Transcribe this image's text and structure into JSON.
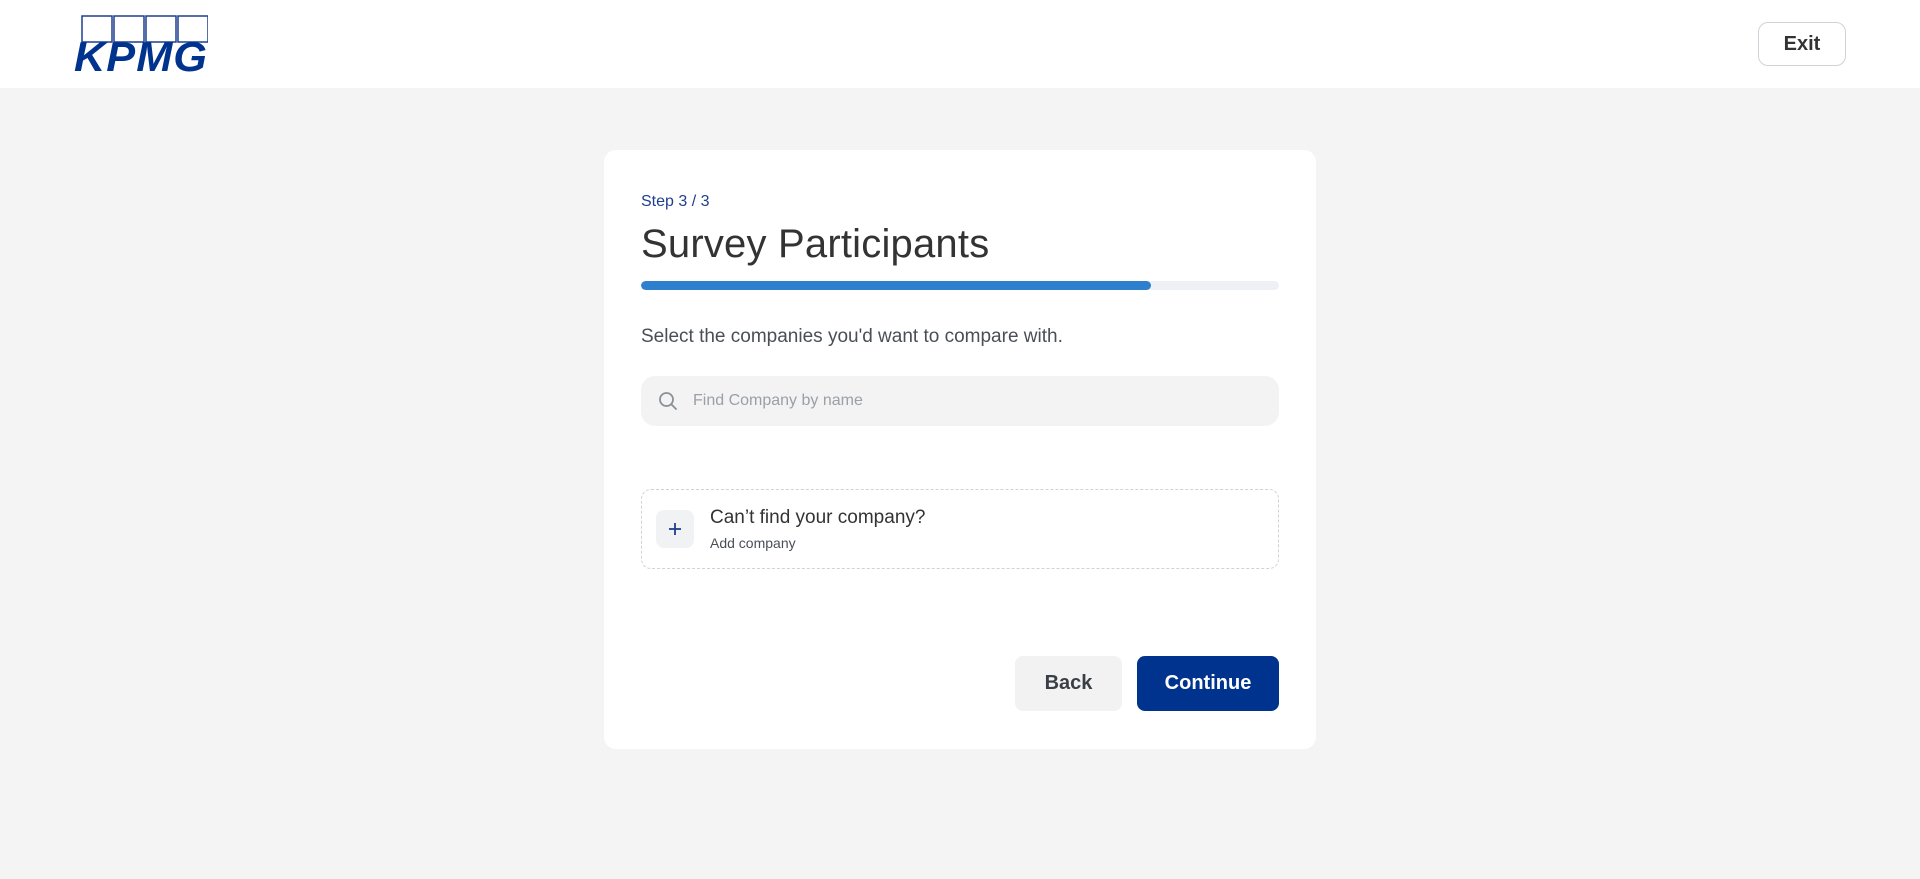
{
  "header": {
    "logo_text": "KPMG",
    "exit_label": "Exit"
  },
  "form": {
    "step_label": "Step 3 / 3",
    "title": "Survey Participants",
    "progress": 0.8,
    "instruction": "Select the companies you'd want to compare with.",
    "search": {
      "placeholder": "Find Company by name",
      "value": ""
    },
    "add_company": {
      "icon": "plus-icon",
      "title": "Can’t find your company?",
      "subtitle": "Add company"
    },
    "back_label": "Back",
    "continue_label": "Continue"
  },
  "colors": {
    "brand": "#00338d",
    "progress": "#2f7fcf",
    "background": "#f4f4f4"
  }
}
